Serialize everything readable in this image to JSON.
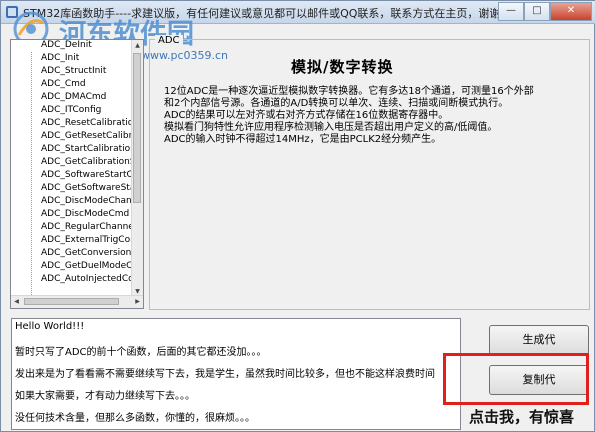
{
  "window": {
    "title": "STM32库函数助手----求建议版，有任何建议或意见都可以邮件或QQ联系，联系方式在主页，谢谢",
    "minimize_label": "—",
    "maximize_label": "□",
    "close_label": "✕"
  },
  "watermark": {
    "site_name": "河东软件园",
    "url": "www.pc0359.cn"
  },
  "function_list": {
    "items": [
      "ADC_DeInit",
      "ADC_Init",
      "ADC_StructInit",
      "ADC_Cmd",
      "ADC_DMACmd",
      "ADC_ITConfig",
      "ADC_ResetCalibration",
      "ADC_GetResetCalibrat",
      "ADC_StartCalibration",
      "ADC_GetCalibrationSta",
      "ADC_SoftwareStartCor",
      "ADC_GetSoftwareStart",
      "ADC_DiscModeChann",
      "ADC_DiscModeCmd",
      "ADC_RegularChannelC",
      "ADC_ExternalTrigConv",
      "ADC_GetConversionVa",
      "ADC_GetDuelModeCo",
      "ADC_AutoInjectedCon"
    ]
  },
  "detail": {
    "group_label": "ADC",
    "title": "模拟/数字转换",
    "lines": [
      "12位ADC是一种逐次逼近型模拟数字转换器。它有多达18个通道，可测量16个外部",
      "和2个内部信号源。各通道的A/D转换可以单次、连续、扫描或间断模式执行。",
      "ADC的结果可以左对齐或右对齐方式存储在16位数据寄存器中。",
      "模拟看门狗特性允许应用程序检测输入电压是否超出用户定义的高/低阈值。",
      "ADC的输入时钟不得超过14MHz，它是由PCLK2经分频产生。"
    ]
  },
  "notes": {
    "lines": [
      "Hello World!!!",
      "暂时只写了ADC的前十个函数，后面的其它都还没加。。。",
      "发出来是为了看看需不需要继续写下去，我是学生，虽然我时间比较多，但也不能这样浪费时间",
      "如果大家需要，才有动力继续写下去。。。",
      "没任何技术含量，但那么多函数，你懂的，很麻烦。。。"
    ]
  },
  "buttons": {
    "generate_label": "生成代",
    "copy_label": "复制代"
  },
  "annotation": {
    "hint_text": "点击我，有惊喜",
    "highlight_color": "#e0201c"
  }
}
